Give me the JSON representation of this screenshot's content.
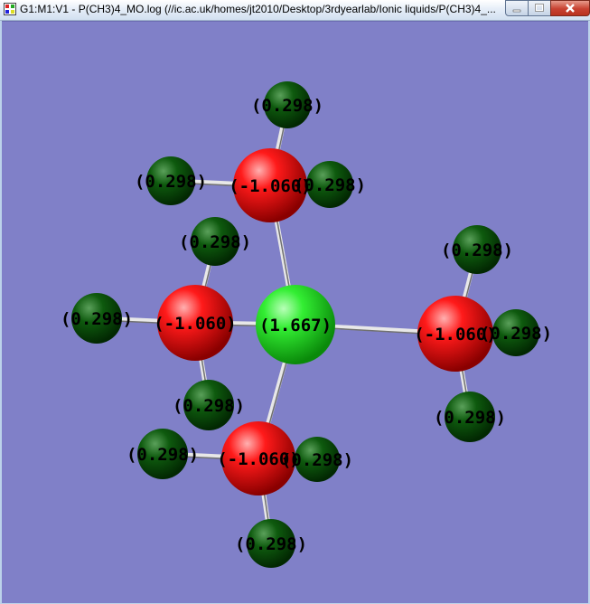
{
  "window": {
    "title": "G1:M1:V1 - P(CH3)4_MO.log (//ic.ac.uk/homes/jt2010/Desktop/3rdyearlab/Ionic liquids/P(CH3)4_...",
    "controls": [
      "minimize",
      "maximize",
      "close"
    ]
  },
  "molecule": {
    "colors": {
      "phosphorus": "#22dd22",
      "carbon": "#ff1a1a",
      "hydrogen": "#0a4a0a",
      "bond": "#e8e8e8",
      "background": "#8080c8"
    },
    "atoms": [
      {
        "element": "P",
        "charge_label": "(1.667)"
      },
      {
        "element": "C",
        "charge_label": "(-1.060)"
      },
      {
        "element": "C",
        "charge_label": "(-1.060)"
      },
      {
        "element": "C",
        "charge_label": "(-1.060)"
      },
      {
        "element": "C",
        "charge_label": "(-1.060)"
      },
      {
        "element": "H",
        "charge_label": "(0.298)"
      },
      {
        "element": "H",
        "charge_label": "(0.298)"
      },
      {
        "element": "H",
        "charge_label": "(0.298)"
      },
      {
        "element": "H",
        "charge_label": "(0.298)"
      },
      {
        "element": "H",
        "charge_label": "(0.298)"
      },
      {
        "element": "H",
        "charge_label": "(0.298)"
      },
      {
        "element": "H",
        "charge_label": "(0.298)"
      },
      {
        "element": "H",
        "charge_label": "(0.298)"
      },
      {
        "element": "H",
        "charge_label": "(0.298)"
      },
      {
        "element": "H",
        "charge_label": "(0.298)"
      },
      {
        "element": "H",
        "charge_label": "(0.298)"
      },
      {
        "element": "H",
        "charge_label": "(0.298)"
      }
    ]
  }
}
